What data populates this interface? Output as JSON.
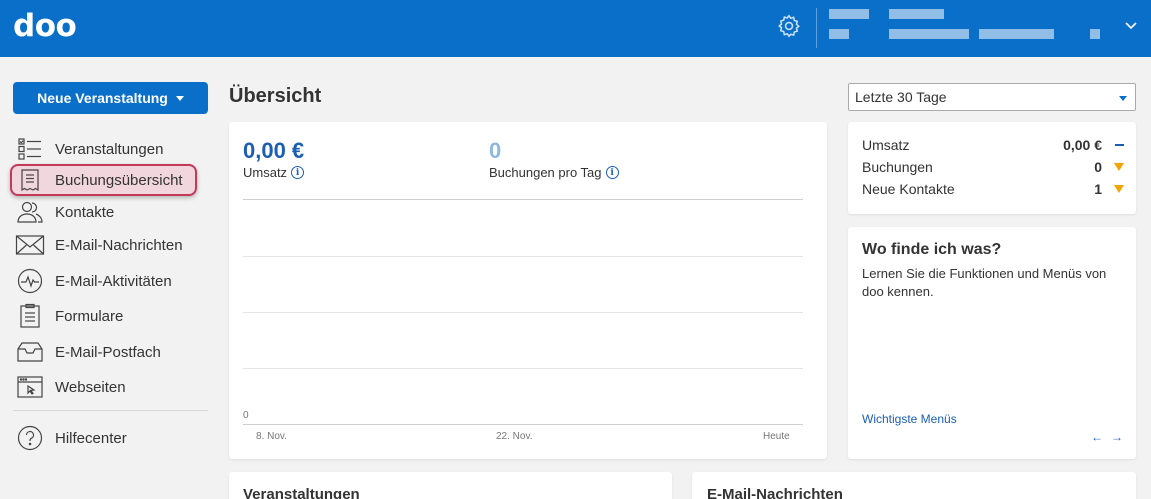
{
  "header": {
    "logo": "doo",
    "icons": {
      "settings": "gear-icon",
      "menu": "chevron-down-icon"
    }
  },
  "sidebar": {
    "new_button": "Neue Veranstaltung",
    "items": [
      {
        "label": "Veranstaltungen",
        "icon": "checklist-icon"
      },
      {
        "label": "Buchungsübersicht",
        "icon": "receipt-icon",
        "active": true
      },
      {
        "label": "Kontakte",
        "icon": "contacts-icon"
      },
      {
        "label": "E-Mail-Nachrichten",
        "icon": "envelope-icon"
      },
      {
        "label": "E-Mail-Aktivitäten",
        "icon": "activity-icon"
      },
      {
        "label": "Formulare",
        "icon": "clipboard-icon"
      },
      {
        "label": "E-Mail-Postfach",
        "icon": "inbox-icon"
      },
      {
        "label": "Webseiten",
        "icon": "webpage-icon"
      }
    ],
    "help": {
      "label": "Hilfecenter",
      "icon": "question-icon"
    }
  },
  "main": {
    "title": "Übersicht",
    "kpis": [
      {
        "value": "0,00 €",
        "label": "Umsatz"
      },
      {
        "value": "0",
        "label": "Buchungen pro Tag"
      }
    ],
    "chart": {
      "y_zero": "0",
      "x_labels": [
        "8. Nov.",
        "22. Nov.",
        "Heute"
      ]
    },
    "bottom_cards": {
      "events_title": "Veranstaltungen",
      "emails_title": "E-Mail-Nachrichten"
    }
  },
  "right": {
    "range_select": "Letzte 30 Tage",
    "stats": [
      {
        "label": "Umsatz",
        "value": "0,00 €",
        "trend": "neutral"
      },
      {
        "label": "Buchungen",
        "value": "0",
        "trend": "down"
      },
      {
        "label": "Neue Kontakte",
        "value": "1",
        "trend": "down"
      }
    ],
    "help": {
      "title": "Wo finde ich was?",
      "text": "Lernen Sie die Funktionen und Menüs von doo kennen.",
      "link": "Wichtigste Menüs",
      "prev": "←",
      "next": "→"
    }
  },
  "colors": {
    "brand": "#0a6fc9",
    "active_bg": "#f1d6dd",
    "active_border": "#c2395a",
    "trend_down": "#f0a500",
    "kpi_secondary": "#8fb8e0"
  }
}
